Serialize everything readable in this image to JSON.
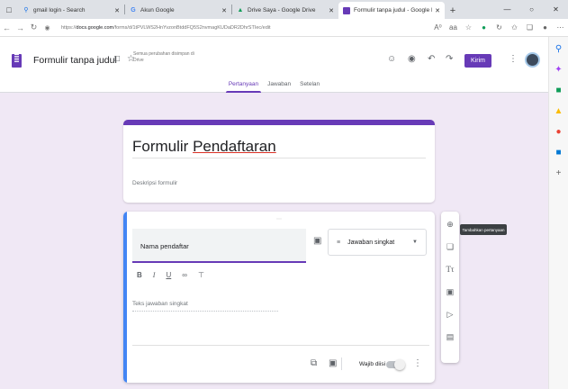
{
  "browser": {
    "tabs": [
      {
        "label": "gmail login - Search",
        "icon": "search-icon"
      },
      {
        "label": "Akun Google",
        "icon": "google-icon"
      },
      {
        "label": "Drive Saya - Google Drive",
        "icon": "drive-icon"
      },
      {
        "label": "Formulir tanpa judul - Google F",
        "icon": "forms-icon",
        "active": true
      }
    ],
    "url_prefix": "https://",
    "url_host": "docs.google.com",
    "url_path": "/forms/d/1tPVLWS2HnYvzonBtddFQ5S2nvmagKUDaDR2DhrSTIec/edit",
    "zoom": "A⁰",
    "read_aloud": "aA"
  },
  "header": {
    "form_title": "Formulir tanpa judul",
    "save_note": "Semua perubahan disimpan di Drive",
    "send_label": "Kirim"
  },
  "form_tabs": [
    "Pertanyaan",
    "Jawaban",
    "Setelan"
  ],
  "title_card": {
    "title_part1": "Formulir ",
    "title_part2": "Pendaftaran",
    "description": "Deskripsi formulir"
  },
  "question": {
    "title_value": "Nama pendaftar",
    "type_label": "Jawaban singkat",
    "answer_placeholder": "Teks jawaban singkat",
    "required_label": "Wajib diisi"
  },
  "tooltip": "Tambahkan pertanyaan",
  "colors": {
    "accent": "#673ab7",
    "focus": "#4285f4"
  }
}
